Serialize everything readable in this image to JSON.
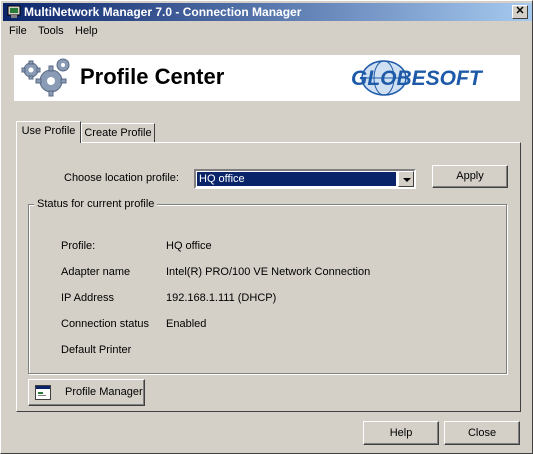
{
  "window": {
    "title": "MultiNetwork Manager 7.0 - Connection Manager",
    "close_label": "✕"
  },
  "menu": [
    "File",
    "Tools",
    "Help"
  ],
  "banner": {
    "title": "Profile Center",
    "logo_text": "GLOBESOFT"
  },
  "tabs": [
    {
      "label": "Use Profile",
      "active": true
    },
    {
      "label": "Create Profile",
      "active": false
    }
  ],
  "location": {
    "label": "Choose location profile:",
    "selected": "HQ office",
    "apply_label": "Apply"
  },
  "status": {
    "group_title": "Status for current profile",
    "rows": [
      {
        "label": "Profile:",
        "value": "HQ office"
      },
      {
        "label": "Adapter name",
        "value": "Intel(R) PRO/100 VE Network Connection"
      },
      {
        "label": "IP Address",
        "value": "192.168.1.111 (DHCP)"
      },
      {
        "label": "Connection status",
        "value": "Enabled"
      },
      {
        "label": "Default Printer",
        "value": ""
      }
    ]
  },
  "profile_manager_label": "Profile Manager",
  "footer": {
    "help_label": "Help",
    "close_label": "Close"
  },
  "colors": {
    "title_start": "#0a246a",
    "title_end": "#a6caf0",
    "logo_blue": "#1e5aa8"
  }
}
